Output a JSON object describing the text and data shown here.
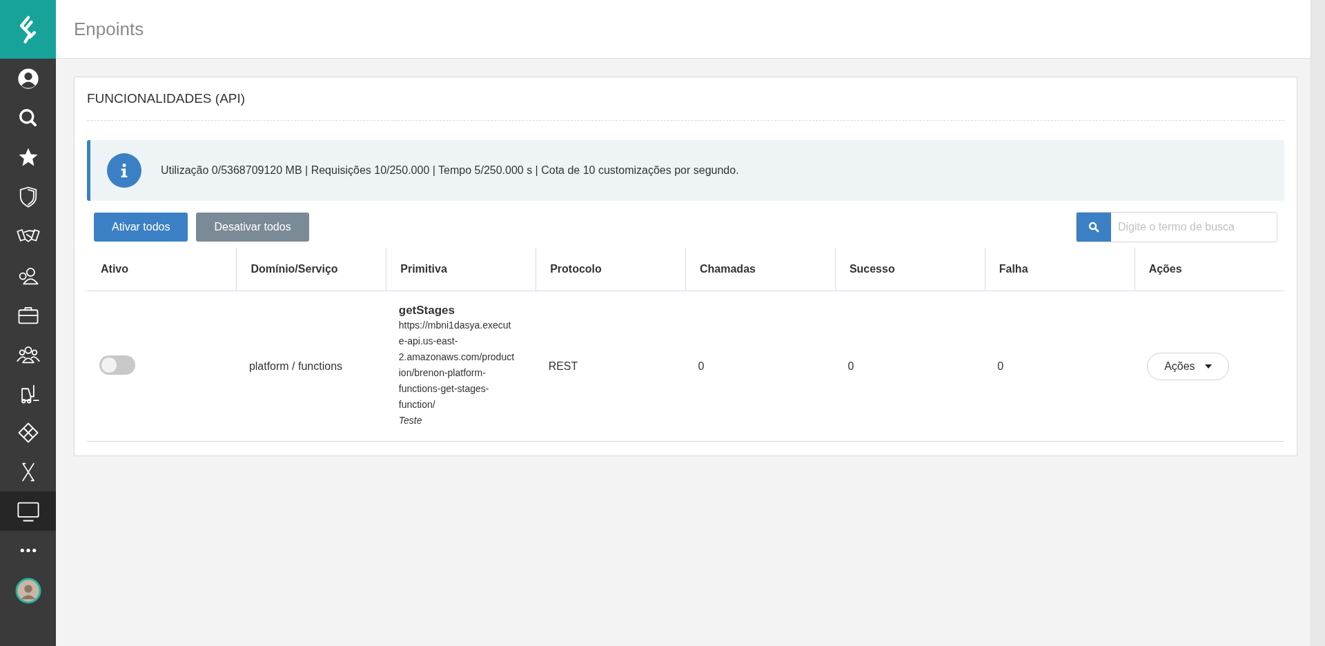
{
  "sidebar": {
    "items": [
      {
        "selected": false
      },
      {
        "selected": false
      },
      {
        "selected": false
      },
      {
        "selected": false
      },
      {
        "selected": false
      },
      {
        "selected": false
      },
      {
        "selected": false
      },
      {
        "selected": false
      },
      {
        "selected": false
      },
      {
        "selected": false
      },
      {
        "selected": false
      },
      {
        "selected": true
      },
      {
        "selected": false
      }
    ]
  },
  "header": {
    "title": "Enpoints"
  },
  "panel": {
    "title": "FUNCIONALIDADES (API)",
    "info": "Utilização 0/5368709120 MB | Requisições 10/250.000 | Tempo 5/250.000 s | Cota de 10 customizações por segundo.",
    "buttons": [
      {
        "label": "Ativar todos",
        "kind": "primary"
      },
      {
        "label": "Desativar todos",
        "kind": "secondary"
      }
    ],
    "search": {
      "placeholder": "Digite o termo de busca"
    },
    "table": {
      "columns": [
        "Ativo",
        "Domínio/Serviço",
        "Primitiva",
        "Protocolo",
        "Chamadas",
        "Sucesso",
        "Falha",
        "Ações"
      ],
      "rows": [
        {
          "on": false,
          "service": "platform / functions",
          "primitive": {
            "name": "getStages",
            "url": "https://mbni1dasya.execute-api.us-east-2.amazonaws.com/production/brenon-platform-functions-get-stages-function/",
            "description": "Teste"
          },
          "protocol": "REST",
          "calls": "0",
          "success": "0",
          "failures": "0",
          "action": "Ações"
        }
      ]
    }
  }
}
